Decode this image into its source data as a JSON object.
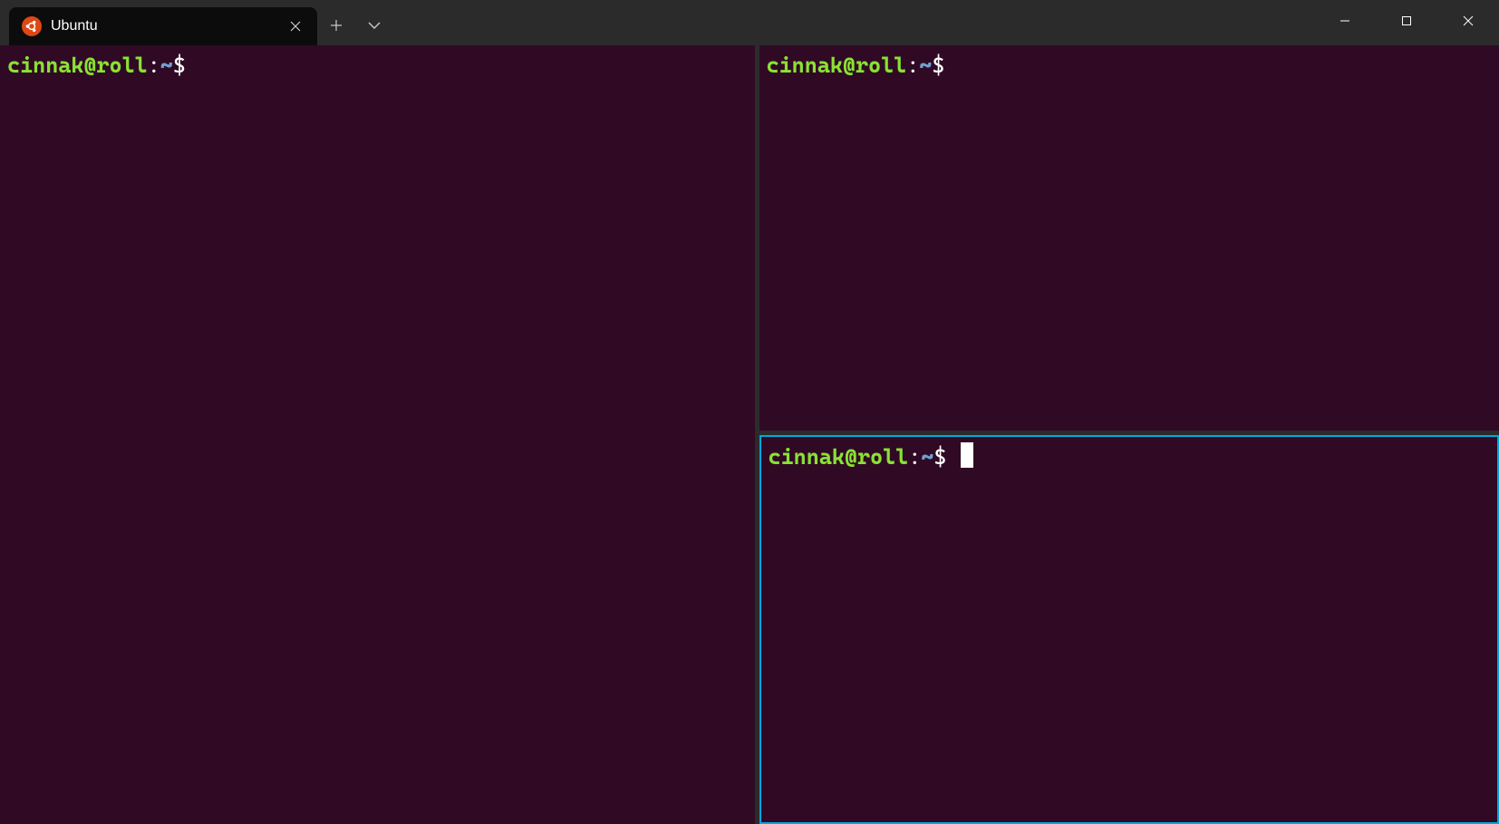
{
  "titlebar": {
    "tab": {
      "title": "Ubuntu",
      "icon_name": "ubuntu-icon"
    }
  },
  "panes": {
    "left": {
      "prompt_user_host": "cinnak@roll",
      "prompt_colon": ":",
      "prompt_path": "~",
      "prompt_symbol": "$",
      "active": false
    },
    "top_right": {
      "prompt_user_host": "cinnak@roll",
      "prompt_colon": ":",
      "prompt_path": "~",
      "prompt_symbol": "$",
      "active": false
    },
    "bottom_right": {
      "prompt_user_host": "cinnak@roll",
      "prompt_colon": ":",
      "prompt_path": "~",
      "prompt_symbol": "$",
      "active": true
    }
  },
  "colors": {
    "tab_bar_bg": "#2b2b2b",
    "active_tab_bg": "#0c0c0c",
    "terminal_bg": "#300a24",
    "prompt_user_fg": "#8ae234",
    "prompt_path_fg": "#729fcf",
    "prompt_text_fg": "#ffffff",
    "active_pane_border": "#00a8dc",
    "ubuntu_orange": "#dd4814"
  }
}
